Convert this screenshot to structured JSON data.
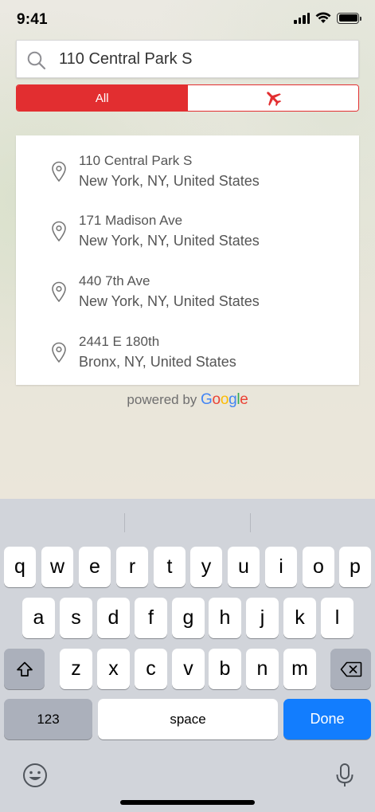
{
  "status_bar": {
    "time": "9:41"
  },
  "search": {
    "value": "110 Central Park S",
    "placeholder": ""
  },
  "filter": {
    "all_label": "All",
    "flights_icon": "airplane-icon",
    "accent_color": "#e22e30"
  },
  "results": [
    {
      "line1": "110 Central Park S",
      "line2": "New York, NY, United States"
    },
    {
      "line1": "171 Madison Ave",
      "line2": "New York, NY, United States"
    },
    {
      "line1": "440 7th Ave",
      "line2": "New York, NY, United States"
    },
    {
      "line1": "2441 E 180th",
      "line2": "Bronx, NY, United States"
    }
  ],
  "attribution": {
    "prefix": "powered by",
    "brand": "Google"
  },
  "keyboard": {
    "row1": [
      "q",
      "w",
      "e",
      "r",
      "t",
      "y",
      "u",
      "i",
      "o",
      "p"
    ],
    "row2": [
      "a",
      "s",
      "d",
      "f",
      "g",
      "h",
      "j",
      "k",
      "l"
    ],
    "row3": [
      "z",
      "x",
      "c",
      "v",
      "b",
      "n",
      "m"
    ],
    "numbers_label": "123",
    "space_label": "space",
    "done_label": "Done",
    "done_color": "#127dfe"
  }
}
